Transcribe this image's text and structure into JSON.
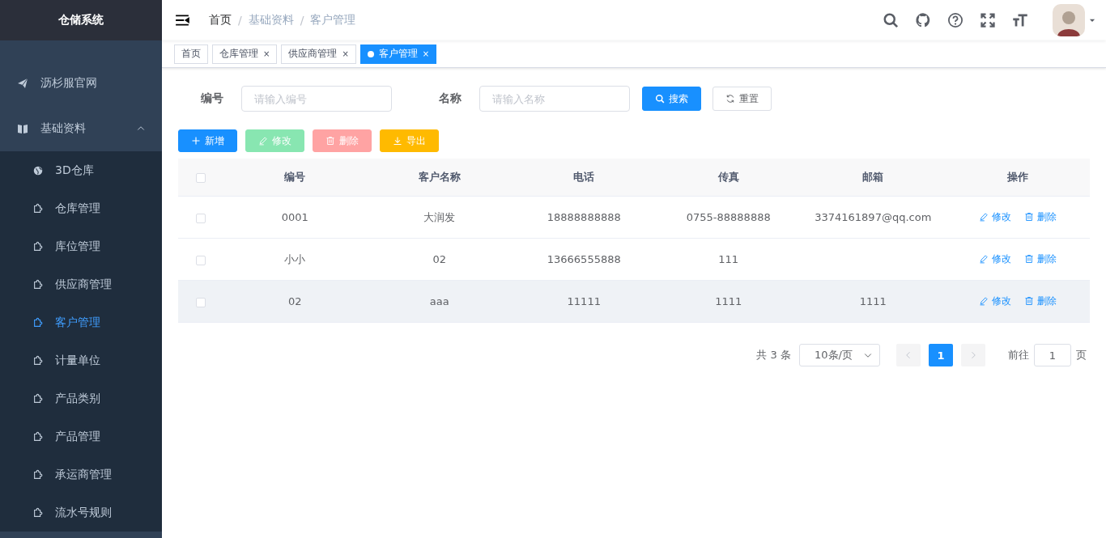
{
  "sidebar": {
    "title": "仓储系统",
    "items": [
      {
        "kind": "link",
        "label": "沥杉服官网"
      },
      {
        "kind": "group",
        "label": "基础资料",
        "expanded": true,
        "children": [
          {
            "label": "3D仓库",
            "selected": false
          },
          {
            "label": "仓库管理",
            "selected": false
          },
          {
            "label": "库位管理",
            "selected": false
          },
          {
            "label": "供应商管理",
            "selected": false
          },
          {
            "label": "客户管理",
            "selected": true
          },
          {
            "label": "计量单位",
            "selected": false
          },
          {
            "label": "产品类别",
            "selected": false
          },
          {
            "label": "产品管理",
            "selected": false
          },
          {
            "label": "承运商管理",
            "selected": false
          },
          {
            "label": "流水号规则",
            "selected": false
          }
        ]
      }
    ]
  },
  "header": {
    "breadcrumb": [
      {
        "kind": "link",
        "text": "首页"
      },
      {
        "kind": "separator",
        "text": "/"
      },
      {
        "kind": "link",
        "text": "基础资料"
      },
      {
        "kind": "separator",
        "text": "/"
      },
      {
        "kind": "current",
        "text": "客户管理"
      }
    ]
  },
  "tags": [
    {
      "label": "首页",
      "selected": false
    },
    {
      "label": "仓库管理",
      "selected": false,
      "close": "×"
    },
    {
      "label": "供应商管理",
      "selected": false,
      "close": "×"
    },
    {
      "label": "客户管理",
      "selected": true,
      "close": "×"
    }
  ],
  "search": {
    "fields": [
      {
        "label": "编号",
        "placeholder": "请输入编号"
      },
      {
        "label": "名称",
        "placeholder": "请输入名称"
      }
    ],
    "buttons": [
      {
        "label": "搜索",
        "kind": "primary"
      },
      {
        "label": "重置",
        "kind": "default"
      }
    ]
  },
  "toolbar": [
    {
      "label": "新增",
      "kind": "primary",
      "disabled": false
    },
    {
      "label": "修改",
      "kind": "success",
      "disabled": true
    },
    {
      "label": "删除",
      "kind": "danger",
      "disabled": true
    },
    {
      "label": "导出",
      "kind": "warning",
      "disabled": false
    }
  ],
  "table": {
    "select_all": {
      "checked": false
    },
    "columns": [
      "编号",
      "客户名称",
      "电话",
      "传真",
      "邮箱",
      "操作"
    ],
    "rows": [
      {
        "checked": false,
        "highlighted": false,
        "cells": [
          "0001",
          "大润发",
          "18888888888",
          "0755-88888888",
          "3374161897@qq.com"
        ],
        "actions": [
          "修改",
          "删除"
        ]
      },
      {
        "checked": false,
        "highlighted": false,
        "cells": [
          "小小",
          "02",
          "13666555888",
          "111",
          null
        ],
        "actions": [
          "修改",
          "删除"
        ]
      },
      {
        "checked": false,
        "highlighted": true,
        "cells": [
          "02",
          "aaa",
          "11111",
          "1111",
          "1111"
        ],
        "actions": [
          "修改",
          "删除"
        ]
      }
    ]
  },
  "pagination": {
    "total": "共 3 条",
    "page_size": "10条/页",
    "prev_disabled": true,
    "next_disabled": true,
    "pages": [
      {
        "label": "1",
        "selected": true
      }
    ],
    "jump_label": "前往",
    "jump_value": "1",
    "suffix": "页"
  }
}
